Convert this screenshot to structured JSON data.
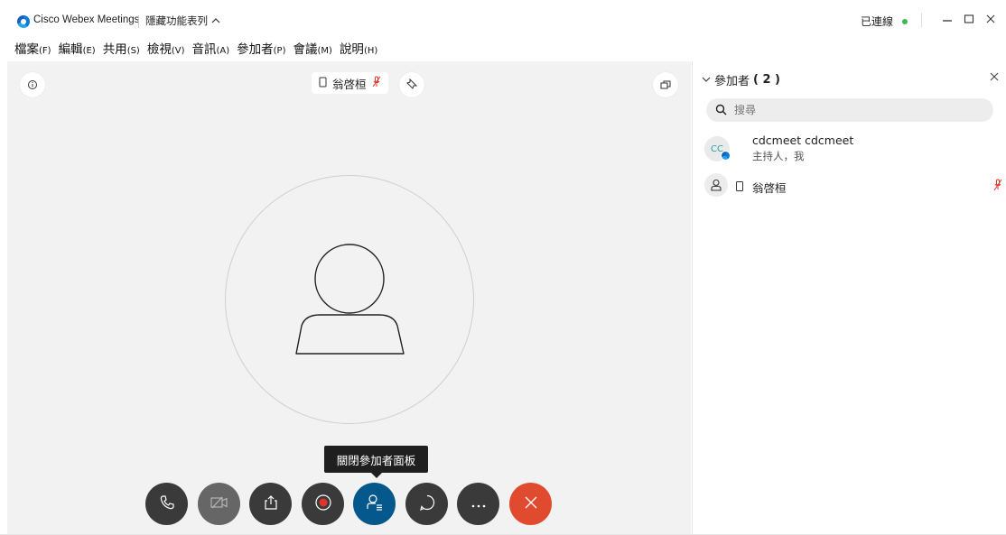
{
  "titlebar": {
    "app_title": "Cisco Webex Meetings",
    "hide_menu_label": "隱藏功能表列",
    "connection_status": "已連線",
    "status_color": "#3cba54"
  },
  "menu": [
    {
      "label": "檔案",
      "accel": "(F)"
    },
    {
      "label": "編輯",
      "accel": "(E)"
    },
    {
      "label": "共用",
      "accel": "(S)"
    },
    {
      "label": "檢視",
      "accel": "(V)"
    },
    {
      "label": "音訊",
      "accel": "(A)"
    },
    {
      "label": "參加者",
      "accel": "(P)"
    },
    {
      "label": "會議",
      "accel": "(M)"
    },
    {
      "label": "說明",
      "accel": "(H)"
    }
  ],
  "stage": {
    "active_speaker_name": "翁啓桓",
    "tooltip": "關閉參加者面板"
  },
  "controls": [
    {
      "name": "audio-button",
      "icon": "phone-icon"
    },
    {
      "name": "video-button",
      "icon": "video-off-icon"
    },
    {
      "name": "share-button",
      "icon": "share-icon"
    },
    {
      "name": "record-button",
      "icon": "record-icon"
    },
    {
      "name": "participants-button",
      "icon": "participants-icon"
    },
    {
      "name": "chat-button",
      "icon": "chat-icon"
    },
    {
      "name": "more-button",
      "icon": "more-icon"
    },
    {
      "name": "leave-button",
      "icon": "close-icon"
    }
  ],
  "panel": {
    "title": "參加者",
    "count": "( 2 )",
    "search_placeholder": "搜尋",
    "participants": [
      {
        "initials": "CC",
        "name": "cdcmeet cdcmeet",
        "role": "主持人，我"
      },
      {
        "name": "翁啓桓",
        "role": ""
      }
    ]
  },
  "colors": {
    "accent_blue": "#05588c",
    "leave_red": "#e04a2f",
    "mute_red": "#e0352b"
  }
}
